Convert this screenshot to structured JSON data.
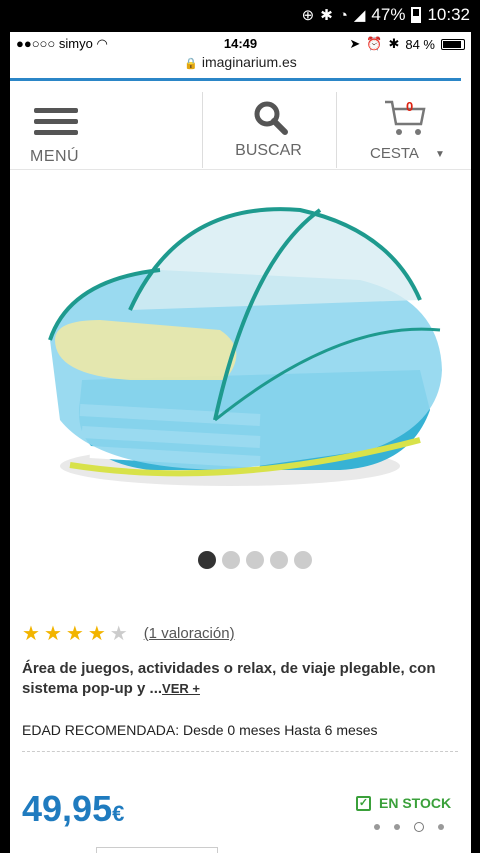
{
  "android_status": {
    "time": "10:32",
    "battery": "47%"
  },
  "ios_status": {
    "carrier": "simyo",
    "time": "14:49",
    "battery": "84 %"
  },
  "browser": {
    "url": "imaginarium.es"
  },
  "header": {
    "menu_label": "MENÚ",
    "search_label": "BUSCAR",
    "cart_label": "CESTA",
    "cart_count": "0"
  },
  "gallery": {
    "total": 5,
    "active_index": 0
  },
  "product": {
    "rating": 4,
    "rating_max": 5,
    "reviews_link": "(1 valoración)",
    "description": "Área de juegos, actividades o relax, de viaje plegable, con sistema pop-up y ...",
    "see_more": "VER +",
    "age_label": "EDAD RECOMENDADA:",
    "age_value": "Desde 0 meses Hasta 6 meses",
    "price": "49,95",
    "currency": "€",
    "stock": "EN STOCK"
  },
  "colors": {
    "accent": "#2b86c7",
    "price": "#1f7bbf",
    "stock": "#3aa03a",
    "star": "#f2b400"
  }
}
